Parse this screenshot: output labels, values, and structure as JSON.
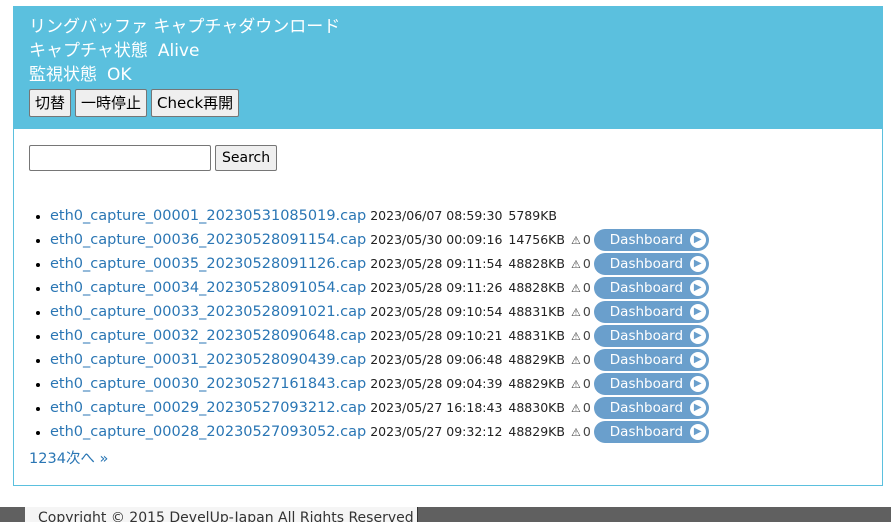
{
  "header": {
    "title": "リングバッファ キャプチャダウンロード",
    "capture_label": "キャプチャ状態",
    "capture_value": "Alive",
    "monitor_label": "監視状態",
    "monitor_value": "OK",
    "buttons": {
      "toggle": "切替",
      "pause": "一時停止",
      "recheck": "Check再開"
    }
  },
  "search": {
    "value": "",
    "placeholder": "",
    "button": "Search"
  },
  "files": [
    {
      "name": "eth0_capture_00001_20230531085019.cap",
      "date": "2023/06/07 08:59:30",
      "size": "5789KB",
      "warnings": null,
      "dashboard": null
    },
    {
      "name": "eth0_capture_00036_20230528091154.cap",
      "date": "2023/05/30 00:09:16",
      "size": "14756KB",
      "warnings": "0",
      "dashboard": "Dashboard"
    },
    {
      "name": "eth0_capture_00035_20230528091126.cap",
      "date": "2023/05/28 09:11:54",
      "size": "48828KB",
      "warnings": "0",
      "dashboard": "Dashboard"
    },
    {
      "name": "eth0_capture_00034_20230528091054.cap",
      "date": "2023/05/28 09:11:26",
      "size": "48828KB",
      "warnings": "0",
      "dashboard": "Dashboard"
    },
    {
      "name": "eth0_capture_00033_20230528091021.cap",
      "date": "2023/05/28 09:10:54",
      "size": "48831KB",
      "warnings": "0",
      "dashboard": "Dashboard"
    },
    {
      "name": "eth0_capture_00032_20230528090648.cap",
      "date": "2023/05/28 09:10:21",
      "size": "48831KB",
      "warnings": "0",
      "dashboard": "Dashboard"
    },
    {
      "name": "eth0_capture_00031_20230528090439.cap",
      "date": "2023/05/28 09:06:48",
      "size": "48829KB",
      "warnings": "0",
      "dashboard": "Dashboard"
    },
    {
      "name": "eth0_capture_00030_20230527161843.cap",
      "date": "2023/05/28 09:04:39",
      "size": "48829KB",
      "warnings": "0",
      "dashboard": "Dashboard"
    },
    {
      "name": "eth0_capture_00029_20230527093212.cap",
      "date": "2023/05/27 16:18:43",
      "size": "48830KB",
      "warnings": "0",
      "dashboard": "Dashboard"
    },
    {
      "name": "eth0_capture_00028_20230527093052.cap",
      "date": "2023/05/27 09:32:12",
      "size": "48829KB",
      "warnings": "0",
      "dashboard": "Dashboard"
    }
  ],
  "pager": {
    "pages": [
      "1",
      "2",
      "3",
      "4"
    ],
    "next": "次へ »"
  },
  "footer": {
    "text": "Copyright © 2015 DevelUp-Japan All Rights Reserved"
  },
  "colors": {
    "accent": "#5bc0de",
    "link": "#2a76b4",
    "dashboard": "#6a9fcc"
  },
  "icons": {
    "warning": "warning-triangle-icon",
    "dashboard_arrow": "chevron-right-circle-icon"
  }
}
